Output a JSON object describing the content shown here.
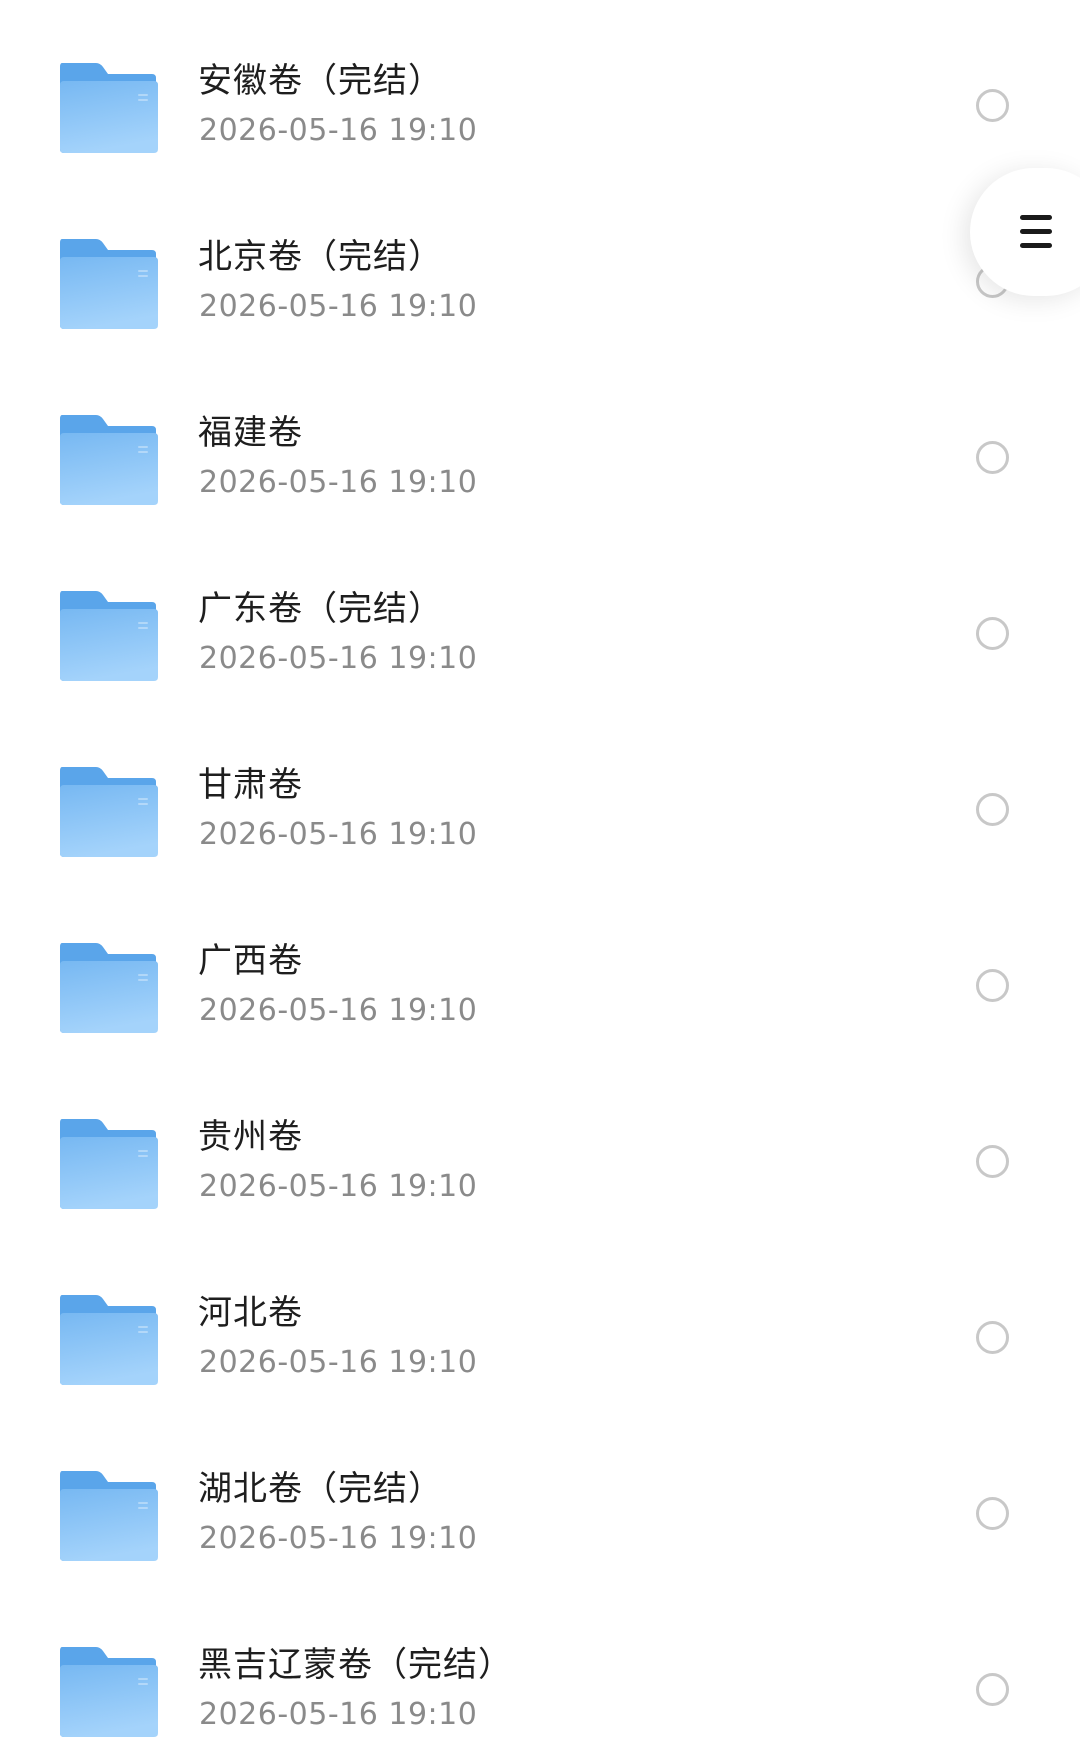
{
  "files": [
    {
      "name": "安徽卷（完结）",
      "date": "2026-05-16 19:10"
    },
    {
      "name": "北京卷（完结）",
      "date": "2026-05-16 19:10"
    },
    {
      "name": "福建卷",
      "date": "2026-05-16 19:10"
    },
    {
      "name": "广东卷（完结）",
      "date": "2026-05-16 19:10"
    },
    {
      "name": "甘肃卷",
      "date": "2026-05-16 19:10"
    },
    {
      "name": "广西卷",
      "date": "2026-05-16 19:10"
    },
    {
      "name": "贵州卷",
      "date": "2026-05-16 19:10"
    },
    {
      "name": "河北卷",
      "date": "2026-05-16 19:10"
    },
    {
      "name": "湖北卷（完结）",
      "date": "2026-05-16 19:10"
    },
    {
      "name": "黑吉辽蒙卷（完结）",
      "date": "2026-05-16 19:10"
    }
  ],
  "icons": {
    "folder": "folder-icon",
    "select": "radio-circle-icon",
    "menu": "hamburger-menu-icon"
  },
  "colors": {
    "folder_back": "#5aa5ea",
    "folder_front_top": "#77b8f2",
    "folder_front_bottom": "#a4d3fb",
    "name_text": "#1e1e1e",
    "date_text": "#8a8a8a",
    "radio_border": "#c8c8c8"
  }
}
